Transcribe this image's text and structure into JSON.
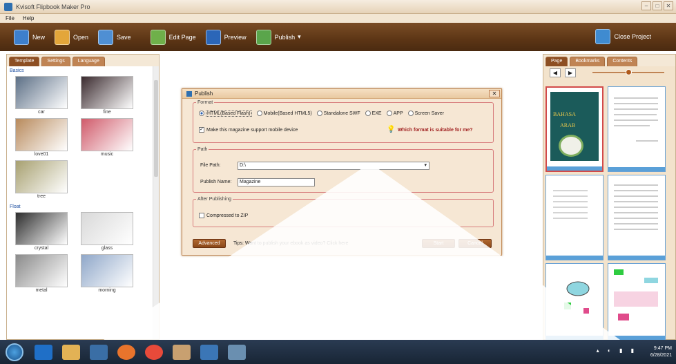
{
  "window": {
    "title": "Kvisoft Flipbook Maker Pro"
  },
  "menu": [
    "File",
    "Help"
  ],
  "toolbar": {
    "new": "New",
    "open": "Open",
    "save": "Save",
    "edit_page": "Edit Page",
    "preview": "Preview",
    "publish": "Publish",
    "close_project": "Close Project",
    "colors": {
      "new": "#3d7fcc",
      "open": "#e3a63a",
      "save": "#4f8fd3",
      "edit": "#6fb04a",
      "preview": "#2b66b8",
      "publish": "#5aa54b",
      "close": "#3f8bd0"
    }
  },
  "left_tabs": [
    "Template",
    "Settings",
    "Language"
  ],
  "sections": {
    "basic": "Basics",
    "float": "Float"
  },
  "templates_basic": [
    {
      "name": "car",
      "color": "#5c6f86"
    },
    {
      "name": "fine",
      "color": "#3a2a2e"
    },
    {
      "name": "love01",
      "color": "#b88a5c"
    },
    {
      "name": "music",
      "color": "#d05a6a"
    },
    {
      "name": "tree",
      "color": "#a7a070"
    }
  ],
  "templates_float": [
    {
      "name": "crystal",
      "color": "#2e2e2e"
    },
    {
      "name": "glass",
      "color": "#d9d9d9"
    },
    {
      "name": "metal",
      "color": "#8a8a8a"
    },
    {
      "name": "morning",
      "color": "#8fa7c9"
    }
  ],
  "right_tabs": [
    "Page",
    "Bookmarks",
    "Contents"
  ],
  "right_tools": {
    "prev": "◀",
    "next": "▶",
    "zoom_level": 0.5
  },
  "cover": {
    "line1": "BAHASA",
    "line2": "ARAB"
  },
  "dialog": {
    "title": "Publish",
    "close": "✕",
    "format_legend": "Format",
    "formats": [
      "HTML(Based Flash)",
      "Mobile(Based HTML5)",
      "Standalone SWF",
      "EXE",
      "APP",
      "Screen Saver"
    ],
    "selected_format": "HTML(Based Flash)",
    "mobile_checkbox": "Make this magazine support mobile device",
    "which_format": "Which format is suitable for me?",
    "path_legend": "Path",
    "file_path_label": "File Path:",
    "file_path_value": "D:\\",
    "publish_name_label": "Publish Name:",
    "publish_name_value": "Magazine",
    "after_legend": "After Publishing",
    "zip_label": "Compressed to ZIP",
    "advanced": "Advanced",
    "tip": "Tips: Want to publish your ebook as video? Click here",
    "start": "Start",
    "cancel": "Cancel"
  },
  "taskbar": {
    "time": "9:47 PM",
    "date": "6/28/2021"
  }
}
